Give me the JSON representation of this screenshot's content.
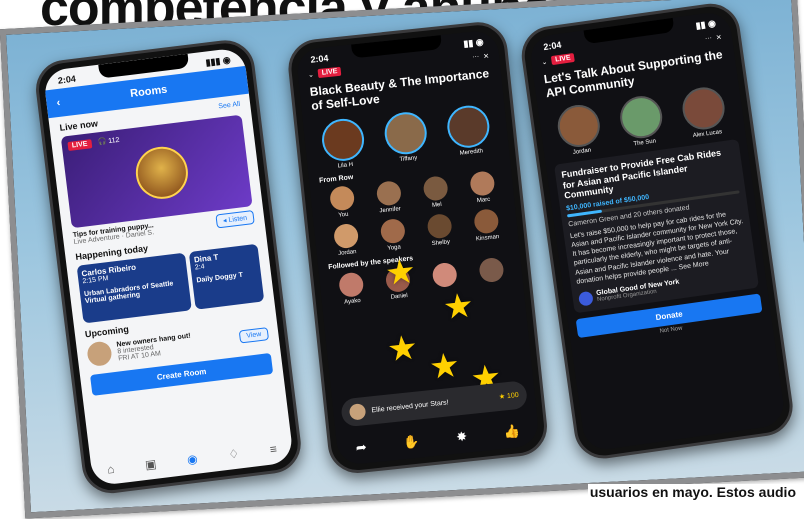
{
  "headline": "competencia y anuncio",
  "caption": "usuarios en mayo. Estos audio",
  "phone1": {
    "time": "2:04",
    "nav_title": "Rooms",
    "live_now": "Live now",
    "see_all": "See All",
    "live_badge": "LIVE",
    "listeners": "112",
    "room_title": "Tips for training puppy...",
    "room_host": "Live Adventure · Daniel S.",
    "listen_label": "Listen",
    "happening_today": "Happening today",
    "today_cards": [
      {
        "host": "Carlos Ribeiro",
        "time": "2:15 PM",
        "title": "Urban Labradors of Seattle Virtual gathering"
      },
      {
        "host": "Dina T",
        "time": "2:4",
        "title": "Daily Doggy T"
      }
    ],
    "upcoming": "Upcoming",
    "upcoming_title": "New owners hang out!",
    "upcoming_sub": "8 interested",
    "upcoming_time": "FRI AT 10 AM",
    "view_label": "View",
    "create_room": "Create Room"
  },
  "phone2": {
    "time": "2:04",
    "live_badge": "LIVE",
    "title": "Black Beauty & The Importance of Self-Love",
    "speakers": [
      "Lila H",
      "Tiffany",
      "Meredith"
    ],
    "from_row_label": "From Row",
    "grid": [
      "You",
      "Jennifer",
      "Mel",
      "Marc",
      "Jordan",
      "Yoga",
      "Shelby",
      "Kinsman"
    ],
    "followed_label": "Followed by the speakers",
    "followed": [
      "Ayako",
      "Daniel",
      "",
      ""
    ],
    "toast": "Ellie received your Stars!",
    "toast_count": "100"
  },
  "phone3": {
    "time": "2:04",
    "live_badge": "LIVE",
    "title": "Let's Talk About Supporting the API Community",
    "speakers": [
      "Jordan",
      "The Sun",
      "Alex Lucas"
    ],
    "fund_title": "Fundraiser to Provide Free Cab Rides for Asian and Pacific Islander Community",
    "raised": "$10,000 raised of $50,000",
    "donors": "Cameron Green and 20 others donated",
    "description": "Let's raise $50,000 to help pay for cab rides for the Asian and Pacific Islander community for New York City. It has become increasingly important to protect those, particularly the elderly, who might be targets of anti-Asian and Pacific Islander violence and hate. Your donation helps provide people ... See More",
    "org": "Global Good of New York",
    "org_sub": "Nonprofit Organization",
    "donate": "Donate",
    "not_now": "Not Now",
    "progress": 0.2
  }
}
